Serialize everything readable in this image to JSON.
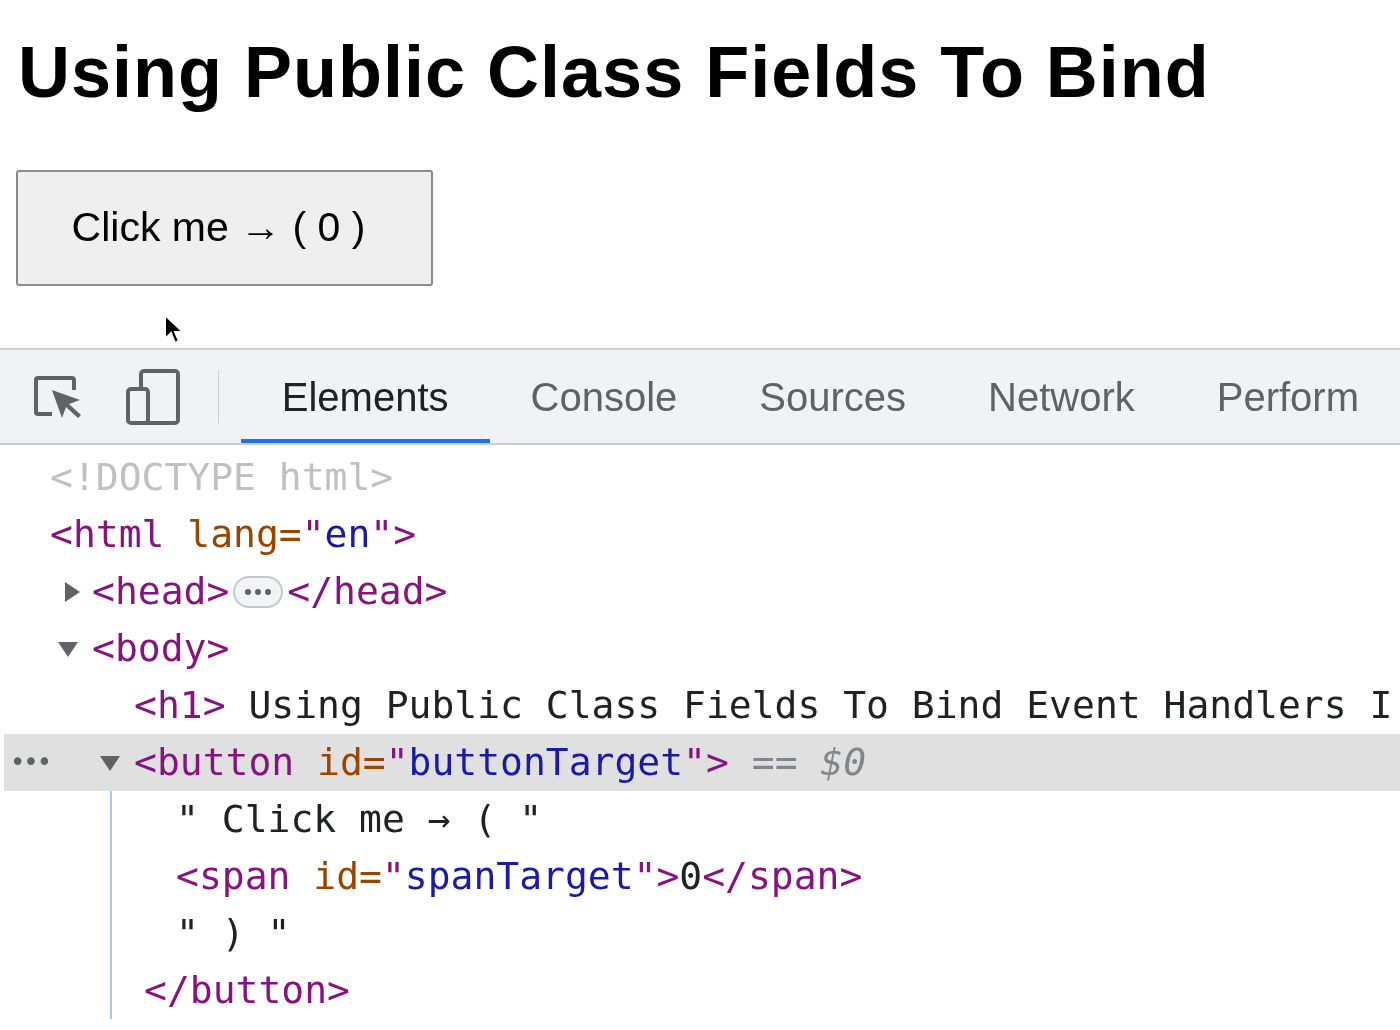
{
  "page": {
    "heading": "Using Public Class Fields To Bind",
    "button": {
      "label": "Click me → ( 0 )"
    }
  },
  "devtools": {
    "tabs": [
      {
        "label": "Elements",
        "selected": true
      },
      {
        "label": "Console",
        "selected": false
      },
      {
        "label": "Sources",
        "selected": false
      },
      {
        "label": "Network",
        "selected": false
      },
      {
        "label": "Perform",
        "selected": false
      }
    ],
    "tree": [
      {
        "tokens": [
          {
            "kind": "doctype",
            "text": "<!DOCTYPE html>"
          }
        ]
      },
      {
        "tokens": [
          {
            "kind": "tag",
            "text": "<html"
          },
          {
            "kind": "attr",
            "text": " lang="
          },
          {
            "kind": "tag",
            "text": "\""
          },
          {
            "kind": "value",
            "text": "en"
          },
          {
            "kind": "tag",
            "text": "\">"
          }
        ],
        "children": [
          {
            "expanded": false,
            "tokens": [
              {
                "kind": "tag",
                "text": "<head>"
              }
            ],
            "closing": [
              {
                "kind": "tag",
                "text": "</head>"
              }
            ]
          },
          {
            "expanded": true,
            "tokens": [
              {
                "kind": "tag",
                "text": "<body>"
              }
            ],
            "children": [
              {
                "tokens": [
                  {
                    "kind": "tag",
                    "text": "<h1>"
                  },
                  {
                    "kind": "text",
                    "text": " Using Public Class Fields To Bind Event Handlers I"
                  }
                ]
              },
              {
                "expanded": true,
                "selected": true,
                "more": "•••",
                "tokens": [
                  {
                    "kind": "tag",
                    "text": "<button"
                  },
                  {
                    "kind": "attr",
                    "text": " id="
                  },
                  {
                    "kind": "tag",
                    "text": "\""
                  },
                  {
                    "kind": "value",
                    "text": "buttonTarget"
                  },
                  {
                    "kind": "tag",
                    "text": "\">"
                  }
                ],
                "suffix": " == ",
                "ref": "$0",
                "children": [
                  {
                    "tokens": [
                      {
                        "kind": "text",
                        "text": "\" Click me → ( \""
                      }
                    ]
                  },
                  {
                    "tokens": [
                      {
                        "kind": "tag",
                        "text": "<span"
                      },
                      {
                        "kind": "attr",
                        "text": " id="
                      },
                      {
                        "kind": "tag",
                        "text": "\""
                      },
                      {
                        "kind": "value",
                        "text": "spanTarget"
                      },
                      {
                        "kind": "tag",
                        "text": "\">"
                      },
                      {
                        "kind": "text",
                        "text": "0"
                      },
                      {
                        "kind": "tag",
                        "text": "</span>"
                      }
                    ]
                  },
                  {
                    "tokens": [
                      {
                        "kind": "text",
                        "text": "\" ) \""
                      }
                    ]
                  }
                ],
                "closing": [
                  {
                    "kind": "tag",
                    "text": "</button>"
                  }
                ]
              }
            ]
          }
        ]
      }
    ]
  }
}
